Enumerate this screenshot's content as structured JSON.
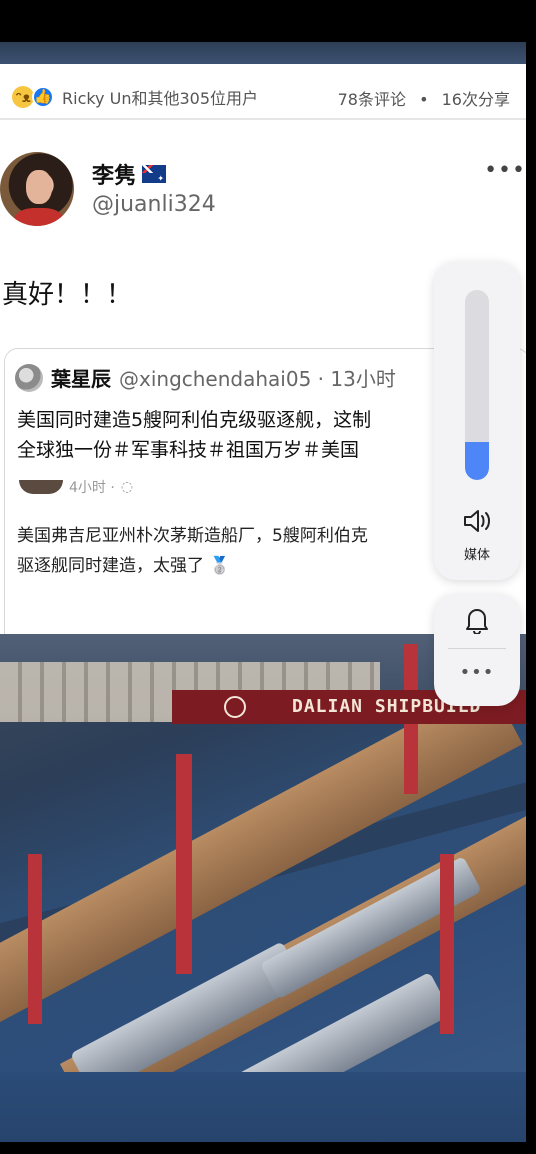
{
  "reactions": {
    "text": "Ricky Un和其他305位用户",
    "haha_icon": "laugh-emoji-icon",
    "like_icon": "thumbs-up-icon"
  },
  "counts": {
    "comments": "78条评论",
    "separator": "•",
    "shares": "16次分享"
  },
  "post": {
    "author_name": "李隽",
    "flag_icon": "australia-flag-icon",
    "handle": "@juanli324",
    "more_label": "•••",
    "text": "真好！！！"
  },
  "quoted": {
    "name": "葉星辰",
    "handle": "@xingchendahai05 · 13小时",
    "line1": "美国同时建造5艘阿利伯克级驱逐舰，这制",
    "line2": "全球独一份＃军事科技＃祖国万岁＃美国",
    "inner_time": "4小时 · ",
    "inner_line1": "美国弗吉尼亚州朴次茅斯造船厂，5艘阿利伯克",
    "inner_line2": "驱逐舰同时建造，太强了 🥈"
  },
  "photo": {
    "banner_text": "DALIAN SHIPBUILD"
  },
  "volume_panel": {
    "level": 0.2,
    "fill_color": "#4f86f7",
    "speaker_icon": "speaker-icon",
    "label": "媒体"
  },
  "notify_panel": {
    "bell_icon": "bell-icon",
    "more_label": "•••"
  }
}
